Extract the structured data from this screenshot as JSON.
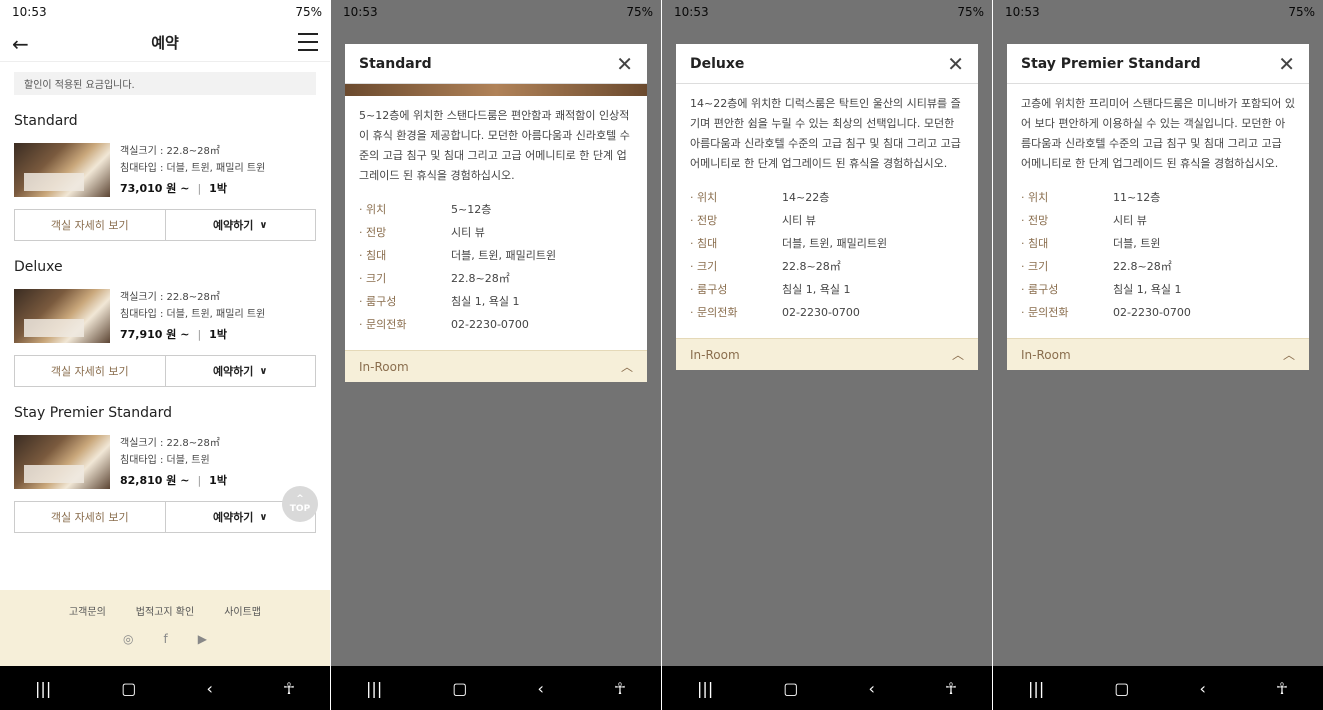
{
  "status": {
    "time": "10:53",
    "battery": "75%"
  },
  "header": {
    "title": "예약"
  },
  "notice": "할인이 적용된 요금입니다.",
  "rooms": [
    {
      "name": "Standard",
      "size": "객실크기 : 22.8~28㎡",
      "bed": "침대타입 : 더블, 트윈, 패밀리 트윈",
      "price": "73,010 원 ~",
      "nights": "1박"
    },
    {
      "name": "Deluxe",
      "size": "객실크기 : 22.8~28㎡",
      "bed": "침대타입 : 더블, 트윈, 패밀리 트윈",
      "price": "77,910 원 ~",
      "nights": "1박"
    },
    {
      "name": "Stay Premier Standard",
      "size": "객실크기 : 22.8~28㎡",
      "bed": "침대타입 : 더블, 트윈",
      "price": "82,810 원 ~",
      "nights": "1박"
    }
  ],
  "buttons": {
    "detail": "객실 자세히 보기",
    "reserve": "예약하기"
  },
  "top_label": "TOP",
  "footer": {
    "links": [
      "고객문의",
      "법적고지 확인",
      "사이트맵"
    ]
  },
  "modals": [
    {
      "title": "Standard",
      "desc": "5~12층에 위치한 스탠다드룸은 편안함과 쾌적함이 인상적이 휴식 환경을 제공합니다. 모던한 아름다움과 신라호텔 수준의 고급 침구 및 침대 그리고 고급 어메니티로 한 단계 업그레이드 된 휴식을 경험하십시오.",
      "specs": [
        [
          "위치",
          "5~12층"
        ],
        [
          "전망",
          "시티 뷰"
        ],
        [
          "침대",
          "더블, 트윈, 패밀리트윈"
        ],
        [
          "크기",
          "22.8~28㎡"
        ],
        [
          "룸구성",
          "침실 1, 욕실 1"
        ],
        [
          "문의전화",
          "02-2230-0700"
        ]
      ],
      "inroom": "In-Room"
    },
    {
      "title": "Deluxe",
      "desc": "14~22층에 위치한 디럭스룸은 탁트인 울산의 시티뷰를 즐기며 편안한 쉼을 누릴 수 있는 최상의 선택입니다. 모던한 아름다움과 신라호텔 수준의 고급 침구 및 침대 그리고 고급 어메니티로 한 단계 업그레이드 된 휴식을 경험하십시오.",
      "specs": [
        [
          "위치",
          "14~22층"
        ],
        [
          "전망",
          "시티 뷰"
        ],
        [
          "침대",
          "더블, 트윈, 패밀리트윈"
        ],
        [
          "크기",
          "22.8~28㎡"
        ],
        [
          "룸구성",
          "침실 1, 욕실 1"
        ],
        [
          "문의전화",
          "02-2230-0700"
        ]
      ],
      "inroom": "In-Room"
    },
    {
      "title": "Stay Premier Standard",
      "desc": "고층에 위치한 프리미어 스탠다드룸은 미니바가 포함되어 있어 보다 편안하게 이용하실 수 있는 객실입니다. 모던한 아름다움과 신라호텔 수준의 고급 침구 및 침대 그리고 고급 어메니티로 한 단계 업그레이드 된 휴식을 경험하십시오.",
      "specs": [
        [
          "위치",
          "11~12층"
        ],
        [
          "전망",
          "시티 뷰"
        ],
        [
          "침대",
          "더블, 트윈"
        ],
        [
          "크기",
          "22.8~28㎡"
        ],
        [
          "룸구성",
          "침실 1, 욕실 1"
        ],
        [
          "문의전화",
          "02-2230-0700"
        ]
      ],
      "inroom": "In-Room"
    }
  ]
}
